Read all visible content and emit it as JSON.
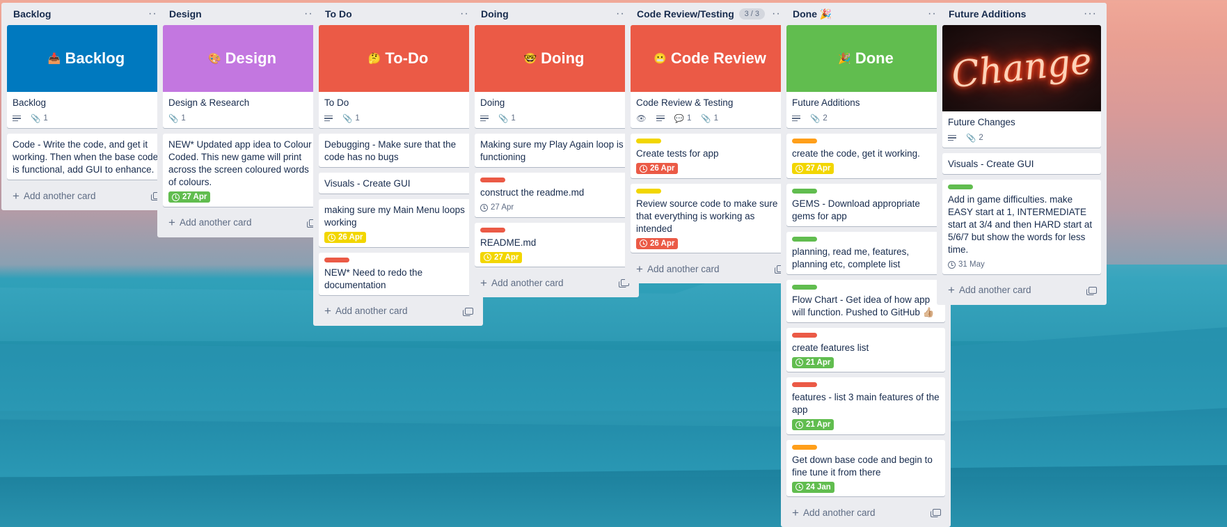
{
  "colors": {
    "green": "#61bd4f",
    "yellow": "#f2d600",
    "orange": "#ff9f1a",
    "red": "#eb5a46",
    "purple": "#c377e0",
    "blue": "#0079bf"
  },
  "add_card_label": "Add another card",
  "lists": [
    {
      "title": "Backlog",
      "cover": {
        "emoji": "📥",
        "text": "Backlog",
        "color": "#0079bf"
      },
      "cover_card": {
        "title": "Backlog",
        "attachments": "1"
      },
      "cards": [
        {
          "title": "Code - Write the code, and get it working. Then when the base code is functional, add GUI to enhance."
        }
      ]
    },
    {
      "title": "Design",
      "cover": {
        "emoji": "🎨",
        "text": "Design",
        "color": "#c377e0"
      },
      "cover_card": {
        "title": "Design & Research",
        "attachments": "1"
      },
      "cards": [
        {
          "title": "NEW* Updated app idea to Colour Coded. This new game will print across the screen coloured words of colours.",
          "due": "27 Apr",
          "due_color": "green"
        }
      ]
    },
    {
      "title": "To Do",
      "cover": {
        "emoji": "🤔",
        "text": "To-Do",
        "color": "#eb5a46"
      },
      "cover_card": {
        "title": "To Do",
        "attachments": "1"
      },
      "cards": [
        {
          "title": "Debugging - Make sure that the code has no bugs"
        },
        {
          "title": "Visuals - Create GUI"
        },
        {
          "title": "making sure my Main Menu loops working",
          "due": "26 Apr",
          "due_color": "yellow"
        },
        {
          "title": "NEW* Need to redo the documentation",
          "label": "red"
        }
      ]
    },
    {
      "title": "Doing",
      "cover": {
        "emoji": "🤓",
        "text": "Doing",
        "color": "#eb5a46"
      },
      "cover_card": {
        "title": "Doing",
        "attachments": "1"
      },
      "cards": [
        {
          "title": "Making sure my Play Again loop is functioning"
        },
        {
          "title": "construct the readme.md",
          "label": "red",
          "due": "27 Apr",
          "due_color": "plain"
        },
        {
          "title": "README.md",
          "label": "red",
          "due": "27 Apr",
          "due_color": "yellow"
        }
      ]
    },
    {
      "title": "Code Review/Testing",
      "count": "3 / 3",
      "cover": {
        "emoji": "😬",
        "text": "Code Review",
        "color": "#eb5a46"
      },
      "cover_card": {
        "title": "Code Review & Testing",
        "comments": "1",
        "attachments": "1",
        "watching": true
      },
      "cards": [
        {
          "title": "Create tests for app",
          "label": "yellow",
          "due": "26 Apr",
          "due_color": "red"
        },
        {
          "title": "Review source code to make sure that everything is working as intended",
          "label": "yellow",
          "due": "26 Apr",
          "due_color": "red"
        }
      ]
    },
    {
      "title": "Done 🎉",
      "cover": {
        "emoji": "🎉",
        "text": "Done",
        "color": "#61bd4f"
      },
      "cover_card": {
        "title": "Future Additions",
        "attachments": "2"
      },
      "cards": [
        {
          "title": "create the code, get it working.",
          "label": "orange",
          "due": "27 Apr",
          "due_color": "yellow"
        },
        {
          "title": "GEMS - Download appropriate gems for app",
          "label": "green"
        },
        {
          "title": "planning, read me, features, planning etc, complete list",
          "label": "green"
        },
        {
          "title": "Flow Chart - Get idea of how app will function. Pushed to GitHub 👍🏼",
          "label": "green"
        },
        {
          "title": "create features list",
          "label": "red",
          "due": "21 Apr",
          "due_color": "green"
        },
        {
          "title": "features - list 3 main features of the app",
          "label": "red",
          "due": "21 Apr",
          "due_color": "green"
        },
        {
          "title": "Get down base code and begin to fine tune it from there",
          "label": "orange",
          "due": "24 Jan",
          "due_color": "green"
        }
      ]
    },
    {
      "title": "Future Additions",
      "cover": {
        "image": "Change",
        "color": "#241010"
      },
      "cover_card": {
        "title": "Future Changes",
        "attachments": "2"
      },
      "cards": [
        {
          "title": "Visuals - Create GUI"
        },
        {
          "title": "Add in game difficulties. make EASY start at 1, INTERMEDIATE start at 3/4 and then HARD start at 5/6/7 but show the words for less time.",
          "label": "green",
          "due": "31 May",
          "due_color": "plain"
        }
      ]
    }
  ]
}
